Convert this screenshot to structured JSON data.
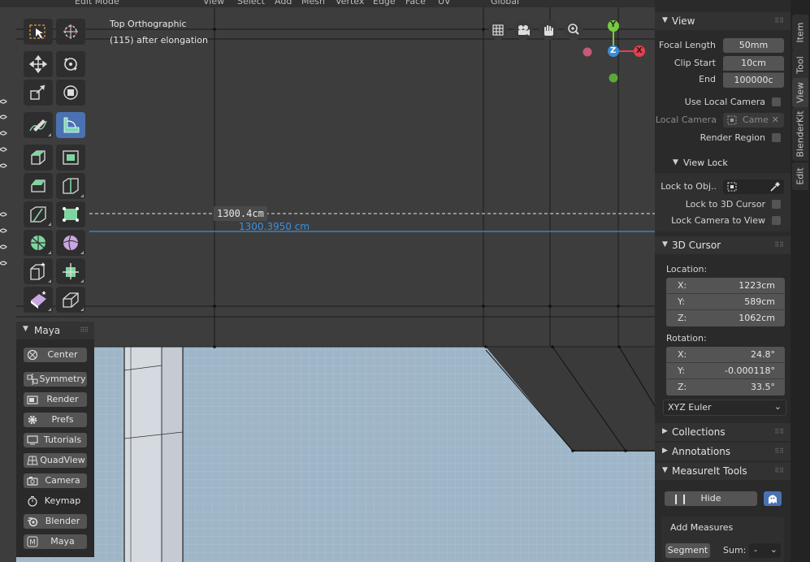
{
  "header": {
    "items": [
      "Edit Mode",
      "View",
      "Select",
      "Add",
      "Mesh",
      "Vertex",
      "Edge",
      "Face",
      "UV",
      "Global"
    ]
  },
  "viewport": {
    "view_name": "Top Orthographic",
    "object_info": "(115) after elongation",
    "measure_label": "1300.4cm",
    "measure_value": "1300.3950 cm",
    "gizmo": {
      "y": "Y",
      "z": "Z",
      "x": "X"
    }
  },
  "maya": {
    "title": "Maya",
    "buttons": [
      {
        "label": "Center",
        "icon": "center-icon"
      },
      {
        "label": "Symmetry",
        "icon": "symmetry-icon"
      },
      {
        "label": "Render",
        "icon": "render-icon"
      },
      {
        "label": "Prefs",
        "icon": "gear-icon"
      },
      {
        "label": "Tutorials",
        "icon": "monitor-icon"
      },
      {
        "label": "QuadView",
        "icon": "quadview-icon"
      },
      {
        "label": "Camera",
        "icon": "camera-icon"
      },
      {
        "label": "Keymap",
        "icon": "stopwatch-icon"
      },
      {
        "label": "Blender",
        "icon": "blender-icon"
      },
      {
        "label": "Maya",
        "icon": "maya-m-icon"
      }
    ]
  },
  "sidebar": {
    "tabs": [
      "Item",
      "Tool",
      "View",
      "BlenderKit",
      "Edit"
    ],
    "view": {
      "title": "View",
      "focal_length_label": "Focal Length",
      "focal_length": "50mm",
      "clip_start_label": "Clip Start",
      "clip_start": "10cm",
      "clip_end_label": "End",
      "clip_end": "100000c",
      "use_local_camera": "Use Local Camera",
      "local_camera_label": "Local Camera",
      "local_camera_value": "Came",
      "render_region": "Render Region"
    },
    "view_lock": {
      "title": "View Lock",
      "lock_to_object": "Lock to Obj..",
      "lock_to_3d_cursor": "Lock to 3D Cursor",
      "lock_camera_to_view": "Lock Camera to View"
    },
    "cursor": {
      "title": "3D Cursor",
      "location_label": "Location:",
      "location": [
        {
          "axis": "X:",
          "value": "1223cm"
        },
        {
          "axis": "Y:",
          "value": "589cm"
        },
        {
          "axis": "Z:",
          "value": "1062cm"
        }
      ],
      "rotation_label": "Rotation:",
      "rotation": [
        {
          "axis": "X:",
          "value": "24.8°"
        },
        {
          "axis": "Y:",
          "value": "-0.000118°"
        },
        {
          "axis": "Z:",
          "value": "33.5°"
        }
      ],
      "rotation_mode": "XYZ Euler"
    },
    "collections": "Collections",
    "annotations": "Annotations",
    "measureit": {
      "title": "MeasureIt Tools",
      "hide_label": "Hide",
      "add_measures": "Add Measures",
      "segment": "Segment",
      "sum_label": "Sum:",
      "sum_value": "-"
    }
  },
  "colors": {
    "accent_blue": "#4a72b3",
    "measure_blue": "#3b8fe0",
    "gizmo_y": "#7ac943",
    "gizmo_z": "#3a8bd6",
    "gizmo_x": "#e0424f",
    "mesh_fill": "#9eb6c8"
  }
}
